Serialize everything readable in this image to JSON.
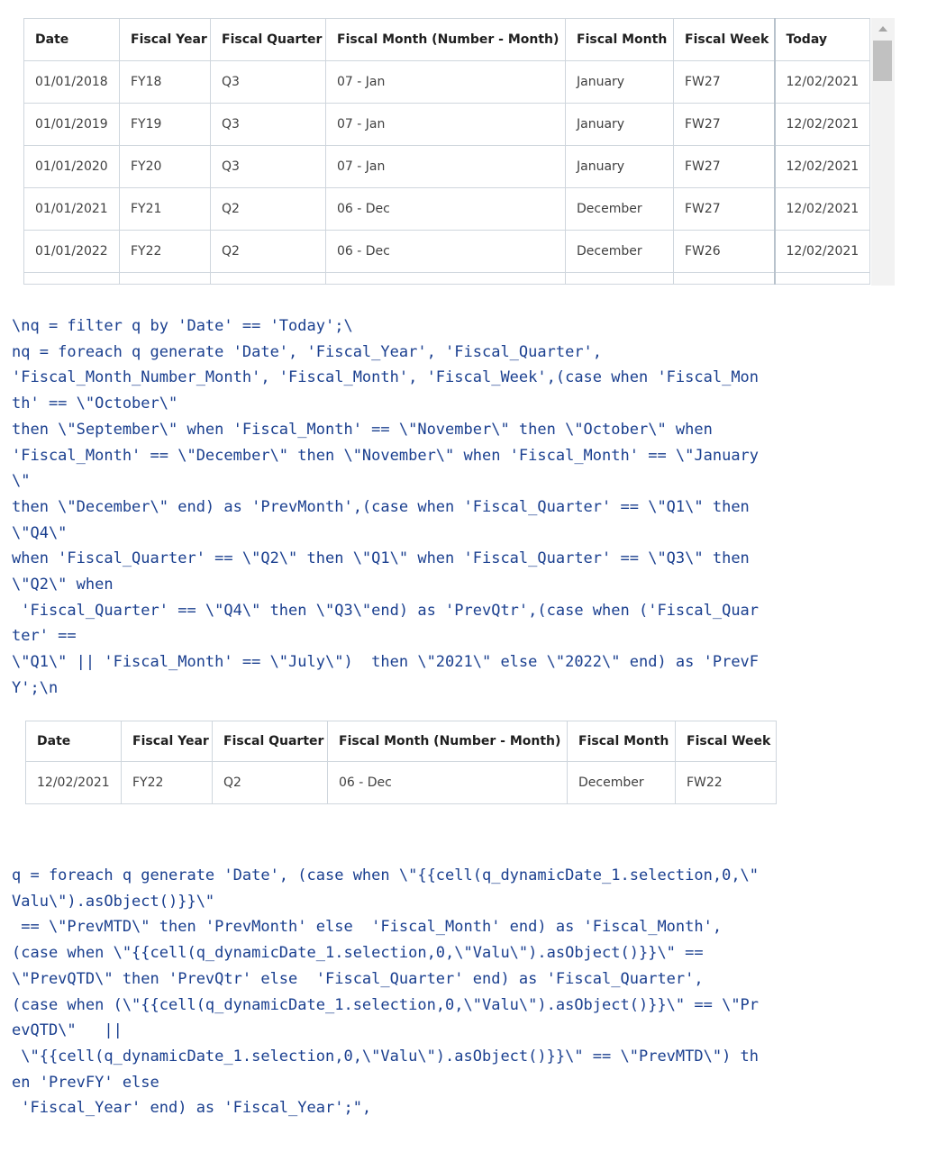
{
  "table1": {
    "headers": [
      "Date",
      "Fiscal Year",
      "Fiscal Quarter",
      "Fiscal Month (Number - Month)",
      "Fiscal Month",
      "Fiscal Week",
      "Today"
    ],
    "rows": [
      [
        "01/01/2018",
        "FY18",
        "Q3",
        "07 - Jan",
        "January",
        "FW27",
        "12/02/2021"
      ],
      [
        "01/01/2019",
        "FY19",
        "Q3",
        "07 - Jan",
        "January",
        "FW27",
        "12/02/2021"
      ],
      [
        "01/01/2020",
        "FY20",
        "Q3",
        "07 - Jan",
        "January",
        "FW27",
        "12/02/2021"
      ],
      [
        "01/01/2021",
        "FY21",
        "Q2",
        "06 - Dec",
        "December",
        "FW27",
        "12/02/2021"
      ],
      [
        "01/01/2022",
        "FY22",
        "Q2",
        "06 - Dec",
        "December",
        "FW26",
        "12/02/2021"
      ]
    ]
  },
  "code1": {
    "lines": [
      "\\nq = filter q by 'Date' == 'Today';\\",
      "nq = foreach q generate 'Date', 'Fiscal_Year', 'Fiscal_Quarter',",
      "'Fiscal_Month_Number_Month', 'Fiscal_Month', 'Fiscal_Week',(case when 'Fiscal_Mon",
      "th' == \\\"October\\\"",
      "then \\\"September\\\" when 'Fiscal_Month' == \\\"November\\\" then \\\"October\\\" when",
      "'Fiscal_Month' == \\\"December\\\" then \\\"November\\\" when 'Fiscal_Month' == \\\"January",
      "\\\"",
      "then \\\"December\\\" end) as 'PrevMonth',(case when 'Fiscal_Quarter' == \\\"Q1\\\" then",
      "\\\"Q4\\\"",
      "when 'Fiscal_Quarter' == \\\"Q2\\\" then \\\"Q1\\\" when 'Fiscal_Quarter' == \\\"Q3\\\" then",
      "\\\"Q2\\\" when",
      " 'Fiscal_Quarter' == \\\"Q4\\\" then \\\"Q3\\\"end) as 'PrevQtr',(case when ('Fiscal_Quar",
      "ter' ==",
      "\\\"Q1\\\" || 'Fiscal_Month' == \\\"July\\\")  then \\\"2021\\\" else \\\"2022\\\" end) as 'PrevF",
      "Y';\\n"
    ]
  },
  "table2": {
    "headers": [
      "Date",
      "Fiscal Year",
      "Fiscal Quarter",
      "Fiscal Month (Number - Month)",
      "Fiscal Month",
      "Fiscal Week"
    ],
    "rows": [
      [
        "12/02/2021",
        "FY22",
        "Q2",
        "06 - Dec",
        "December",
        "FW22"
      ]
    ]
  },
  "code2": {
    "lines": [
      "q = foreach q generate 'Date', (case when \\\"{{cell(q_dynamicDate_1.selection,0,\\\"",
      "Valu\\\").asObject()}}\\\"",
      " == \\\"PrevMTD\\\" then 'PrevMonth' else  'Fiscal_Month' end) as 'Fiscal_Month',",
      "(case when \\\"{{cell(q_dynamicDate_1.selection,0,\\\"Valu\\\").asObject()}}\\\" ==",
      "\\\"PrevQTD\\\" then 'PrevQtr' else  'Fiscal_Quarter' end) as 'Fiscal_Quarter',",
      "(case when (\\\"{{cell(q_dynamicDate_1.selection,0,\\\"Valu\\\").asObject()}}\\\" == \\\"Pr",
      "evQTD\\\"   ||",
      " \\\"{{cell(q_dynamicDate_1.selection,0,\\\"Valu\\\").asObject()}}\\\" == \\\"PrevMTD\\\") th",
      "en 'PrevFY' else",
      " 'Fiscal_Year' end) as 'Fiscal_Year';\","
    ]
  }
}
